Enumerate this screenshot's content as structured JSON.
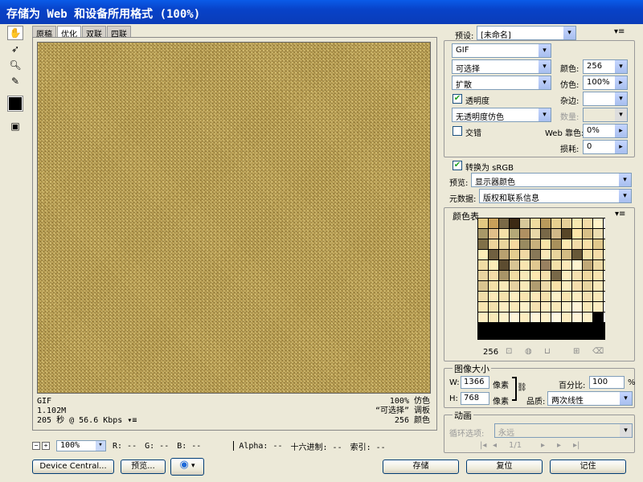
{
  "window": {
    "title": "存储为 Web 和设备所用格式 (100%)"
  },
  "tabs": [
    {
      "label": "原稿"
    },
    {
      "label": "优化"
    },
    {
      "label": "双联"
    },
    {
      "label": "四联"
    }
  ],
  "preview_info": {
    "left": [
      "GIF",
      "1.102M",
      "205 秒 @ 56.6 Kbps"
    ],
    "right": [
      "100% 仿色",
      "“可选择” 调板",
      "256 颜色"
    ]
  },
  "statusbar": {
    "zoom": "100%",
    "r": "R: --",
    "g": "G: --",
    "b": "B: --",
    "alpha": "Alpha: --",
    "hex": "十六进制: --",
    "index": "索引: --"
  },
  "settings": {
    "preset_label": "预设:",
    "preset_value": "[未命名]",
    "format": "GIF",
    "reduction": "可选择",
    "colors_label": "颜色:",
    "colors_value": "256",
    "dither": "扩散",
    "dither_label": "仿色:",
    "dither_value": "100%",
    "transparency_label": "透明度",
    "matte_label": "杂边:",
    "transparency_dither": "无透明度仿色",
    "amount_label": "数量:",
    "interlaced_label": "交错",
    "web_snap_label": "Web 靠色:",
    "web_snap_value": "0%",
    "lossy_label": "损耗:",
    "lossy_value": "0",
    "convert_srgb_label": "转换为 sRGB",
    "preview_label": "预览:",
    "preview_value": "显示器颜色",
    "metadata_label": "元数据:",
    "metadata_value": "版权和联系信息"
  },
  "color_table": {
    "title": "颜色表",
    "count": "256",
    "colors": [
      "#e2c882",
      "#c8a05a",
      "#7a6a48",
      "#3c2a14",
      "#d8c89a",
      "#f0dca0",
      "#b89a5c",
      "#e8d090",
      "#e6cf98",
      "#f8e8b0",
      "#f4dca8",
      "#fff2c8",
      "#ffffff",
      "#a89868",
      "#e2c08a",
      "#f4e0a8",
      "#b4a878",
      "#b09062",
      "#e8d8a8",
      "#786848",
      "#d0b888",
      "#584628",
      "#fce4a8",
      "#d8c088",
      "#ecdcb0",
      "#ffffe0",
      "#807048",
      "#ecd49c",
      "#e8d49c",
      "#f4d8a0",
      "#988a60",
      "#c8b07c",
      "#f8e4a8",
      "#a8905c",
      "#fce8b0",
      "#f0dca8",
      "#f8e0a8",
      "#e0c88c",
      "#f8ecc0",
      "#fcecb8",
      "#706040",
      "#b8a070",
      "#e4cc90",
      "#f0d8a4",
      "#887858",
      "#f8e8b8",
      "#e8d49c",
      "#d4bc84",
      "#685838",
      "#f4e0a8",
      "#f4dca8",
      "#fff0c8",
      "#f0dca4",
      "#fcecb8",
      "#5c4c30",
      "#d8c494",
      "#f8e4b0",
      "#e0c890",
      "#988060",
      "#f4e0a8",
      "#fce8b8",
      "#fff4d0",
      "#c0a878",
      "#ecd8a4",
      "#f4e4b8",
      "#e8d4a0",
      "#f4dca8",
      "#a89468",
      "#f0dca4",
      "#f8e8b8",
      "#fce8b0",
      "#f4e0ac",
      "#786848",
      "#fcecc0",
      "#f4e0b0",
      "#f0d8a0",
      "#f8e4b0",
      "#fff8d8",
      "#d8c490",
      "#f4e0a8",
      "#f8e8b8",
      "#e4d0a0",
      "#f8e8b8",
      "#b09c70",
      "#ecd8a8",
      "#f8e0a8",
      "#fcecc0",
      "#f4dcac",
      "#e8d4a0",
      "#f8e8b8",
      "#fff0d0",
      "#f0dca8",
      "#fce8b8",
      "#f4e0ac",
      "#fcecc0",
      "#f8e4b0",
      "#fce8b8",
      "#f4e0ac",
      "#fcf0c8",
      "#f8e4b0",
      "#fcecc0",
      "#f4e0b0",
      "#f8e8b8",
      "#fff8e0",
      "#f8e4b0",
      "#f4e0ac",
      "#fcecc0",
      "#f8e8b8",
      "#fcf0c8",
      "#f4e0b0",
      "#fcecc0",
      "#f8e8b8",
      "#fcf0c8",
      "#fff4d8",
      "#f8e8b8",
      "#fcecc0",
      "#fffae8",
      "#fcecc0",
      "#f8e8b8",
      "#fcf0c8",
      "#fff4d8",
      "#fcecc0",
      "#fff4d8",
      "#fcf0c8",
      "#fff8e0",
      "#fcecc0",
      "#fff4d8",
      "#fcf0c8",
      "#000000",
      "#ffffff"
    ]
  },
  "image_size": {
    "title": "图像大小",
    "w_label": "W:",
    "w_value": "1366",
    "h_label": "H:",
    "h_value": "768",
    "unit": "像素",
    "percent_label": "百分比:",
    "percent_value": "100",
    "percent_unit": "%",
    "quality_label": "品质:",
    "quality_value": "两次线性"
  },
  "animation": {
    "title": "动画",
    "loop_label": "循环选项:",
    "loop_value": "永远",
    "frame": "1/1"
  },
  "buttons": {
    "device_central": "Device Central...",
    "preview": "预览...",
    "save": "存储",
    "reset": "复位",
    "remember": "记住"
  }
}
